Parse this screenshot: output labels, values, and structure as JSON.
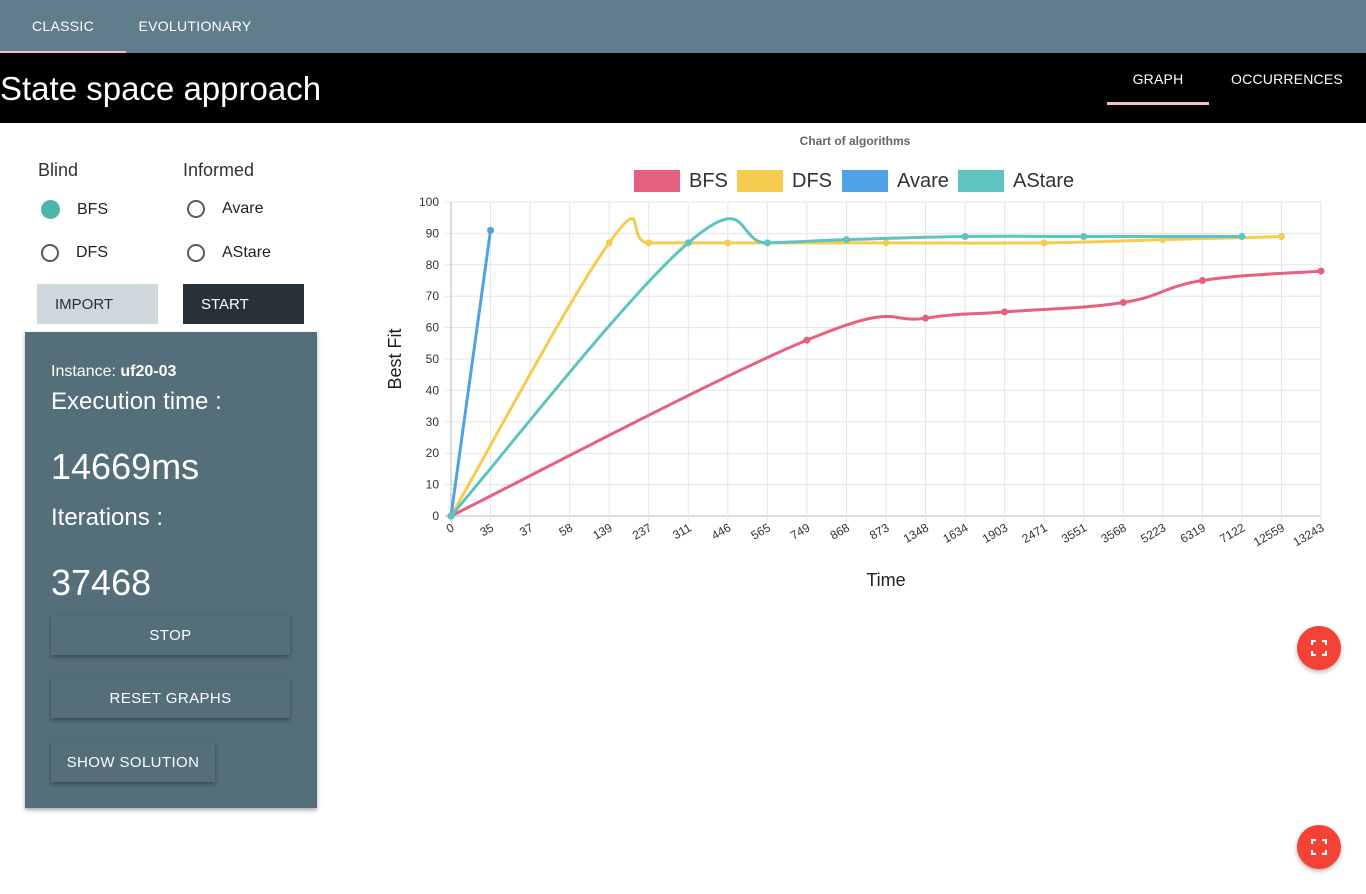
{
  "top_tabs": [
    {
      "label": "CLASSIC",
      "active": true
    },
    {
      "label": "EVOLUTIONARY",
      "active": false
    }
  ],
  "header": {
    "title": "State space approach",
    "tabs": [
      {
        "label": "GRAPH",
        "active": true
      },
      {
        "label": "OCCURRENCES",
        "active": false
      }
    ]
  },
  "controls": {
    "blind": {
      "title": "Blind",
      "options": [
        {
          "label": "BFS",
          "checked": true
        },
        {
          "label": "DFS",
          "checked": false
        }
      ]
    },
    "informed": {
      "title": "Informed",
      "options": [
        {
          "label": "Avare",
          "checked": false
        },
        {
          "label": "AStare",
          "checked": false
        }
      ]
    },
    "import_label": "IMPORT",
    "start_label": "START"
  },
  "stats": {
    "instance_label": "Instance: ",
    "instance_value": "uf20-03",
    "exec_time_label": "Execution time :",
    "exec_time_value": "14669ms",
    "iterations_label": "Iterations :",
    "iterations_value": "37468",
    "stop_label": "STOP",
    "reset_label": "RESET GRAPHS",
    "show_solution_label": "SHOW SOLUTION"
  },
  "fabs": [
    {
      "icon": "fullscreen-icon"
    },
    {
      "icon": "fullscreen-icon"
    }
  ],
  "colors": {
    "topbar": "#607d8b",
    "accent": "#f8bbd0",
    "card": "#546e7a",
    "fab": "#f44336",
    "bfs": "#e8607f",
    "dfs": "#f5cc50",
    "avare": "#50a2e6",
    "astare": "#5ec4c0"
  },
  "chart_data": {
    "type": "line",
    "title": "Chart of algorithms",
    "xlabel": "Time",
    "ylabel": "Best Fit",
    "ylim": [
      0,
      100
    ],
    "yticks": [
      0,
      10,
      20,
      30,
      40,
      50,
      60,
      70,
      80,
      90,
      100
    ],
    "categories": [
      "0",
      "35",
      "37",
      "58",
      "139",
      "237",
      "311",
      "446",
      "565",
      "749",
      "868",
      "873",
      "1348",
      "1634",
      "1903",
      "2471",
      "3551",
      "3568",
      "5223",
      "6319",
      "7122",
      "12559",
      "13243"
    ],
    "legend_position": "top",
    "grid": true,
    "series": [
      {
        "name": "BFS",
        "color": "#e8607f",
        "points": [
          [
            0,
            0
          ],
          [
            9,
            56
          ],
          [
            12,
            63
          ],
          [
            14,
            65
          ],
          [
            17,
            68
          ],
          [
            19,
            75
          ],
          [
            22,
            78
          ]
        ]
      },
      {
        "name": "DFS",
        "color": "#f5cc50",
        "points": [
          [
            0,
            0
          ],
          [
            4,
            87
          ],
          [
            5,
            87
          ],
          [
            7,
            87
          ],
          [
            11,
            87
          ],
          [
            15,
            87
          ],
          [
            18,
            88
          ],
          [
            21,
            89
          ]
        ]
      },
      {
        "name": "Avare",
        "color": "#50a2e6",
        "points": [
          [
            0,
            0
          ],
          [
            1,
            91
          ]
        ]
      },
      {
        "name": "AStare",
        "color": "#5ec4c0",
        "points": [
          [
            0,
            0
          ],
          [
            6,
            87
          ],
          [
            8,
            87
          ],
          [
            10,
            88
          ],
          [
            13,
            89
          ],
          [
            16,
            89
          ],
          [
            20,
            89
          ]
        ]
      }
    ]
  }
}
